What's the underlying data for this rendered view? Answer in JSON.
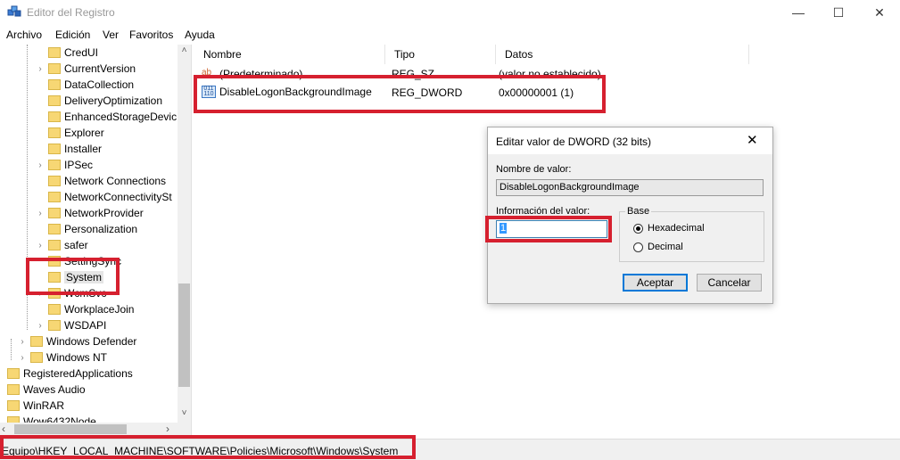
{
  "window": {
    "title": "Editor del Registro",
    "minimize_glyph": "—",
    "maximize_glyph": "☐",
    "close_glyph": "✕"
  },
  "menu": [
    "Archivo",
    "Edición",
    "Ver",
    "Favoritos",
    "Ayuda"
  ],
  "tree": {
    "items": [
      {
        "label": "CredUI",
        "expander": ""
      },
      {
        "label": "CurrentVersion",
        "expander": "›"
      },
      {
        "label": "DataCollection",
        "expander": ""
      },
      {
        "label": "DeliveryOptimization",
        "expander": ""
      },
      {
        "label": "EnhancedStorageDevic",
        "expander": ""
      },
      {
        "label": "Explorer",
        "expander": ""
      },
      {
        "label": "Installer",
        "expander": ""
      },
      {
        "label": "IPSec",
        "expander": "›"
      },
      {
        "label": "Network Connections",
        "expander": ""
      },
      {
        "label": "NetworkConnectivitySt",
        "expander": ""
      },
      {
        "label": "NetworkProvider",
        "expander": "›"
      },
      {
        "label": "Personalization",
        "expander": ""
      },
      {
        "label": "safer",
        "expander": "›"
      },
      {
        "label": "SettingSync",
        "expander": ""
      },
      {
        "label": "System",
        "expander": ""
      },
      {
        "label": "WcmSvc",
        "expander": "›"
      },
      {
        "label": "WorkplaceJoin",
        "expander": ""
      },
      {
        "label": "WSDAPI",
        "expander": "›"
      },
      {
        "label": "Windows Defender",
        "expander": "›"
      },
      {
        "label": "Windows NT",
        "expander": "›"
      },
      {
        "label": "RegisteredApplications",
        "expander": ""
      },
      {
        "label": "Waves Audio",
        "expander": ""
      },
      {
        "label": "WinRAR",
        "expander": ""
      },
      {
        "label": "Wow6432Node",
        "expander": ""
      }
    ],
    "scroll_up": "˄",
    "scroll_down": "˅",
    "scroll_left": "‹",
    "scroll_right": "›"
  },
  "list": {
    "columns": [
      "Nombre",
      "Tipo",
      "Datos"
    ],
    "rows": [
      {
        "name": "(Predeterminado)",
        "type": "REG_SZ",
        "data": "(valor no establecido)",
        "icon": "string-value-icon"
      },
      {
        "name": "DisableLogonBackgroundImage",
        "type": "REG_DWORD",
        "data": "0x00000001 (1)",
        "icon": "dword-value-icon"
      }
    ]
  },
  "status": {
    "path": "Equipo\\HKEY_LOCAL_MACHINE\\SOFTWARE\\Policies\\Microsoft\\Windows\\System"
  },
  "dialog": {
    "title": "Editar valor de DWORD (32 bits)",
    "name_label": "Nombre de valor:",
    "name_value": "DisableLogonBackgroundImage",
    "data_label": "Información del valor:",
    "data_value": "1",
    "base_label": "Base",
    "hex_label": "Hexadecimal",
    "dec_label": "Decimal",
    "base_selected": "Hexadecimal",
    "ok_label": "Aceptar",
    "cancel_label": "Cancelar",
    "close_glyph": "✕"
  },
  "colors": {
    "highlight": "#d6202f",
    "folder": "#f7d774",
    "accent": "#0078d7"
  }
}
